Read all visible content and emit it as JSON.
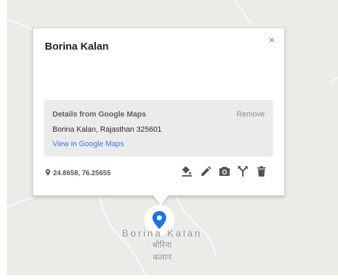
{
  "popup": {
    "title": "Borina Kalan",
    "close_glyph": "×",
    "details": {
      "heading": "Details from Google Maps",
      "remove_label": "Remove",
      "address": "Borina Kalan, Rajasthan 325601",
      "view_link": "View in Google Maps"
    },
    "coordinates": "24.8658, 76.25655",
    "tools": [
      "paint-bucket-icon",
      "pencil-icon",
      "camera-icon",
      "directions-icon",
      "trash-icon"
    ]
  },
  "map": {
    "label_latin": "Borina Kalan",
    "label_hindi_line1": "बोरिना",
    "label_hindi_line2": "कलान"
  },
  "colors": {
    "marker": "#1a73e8",
    "link": "#3b78e7",
    "map_background": "#ecebe8"
  }
}
